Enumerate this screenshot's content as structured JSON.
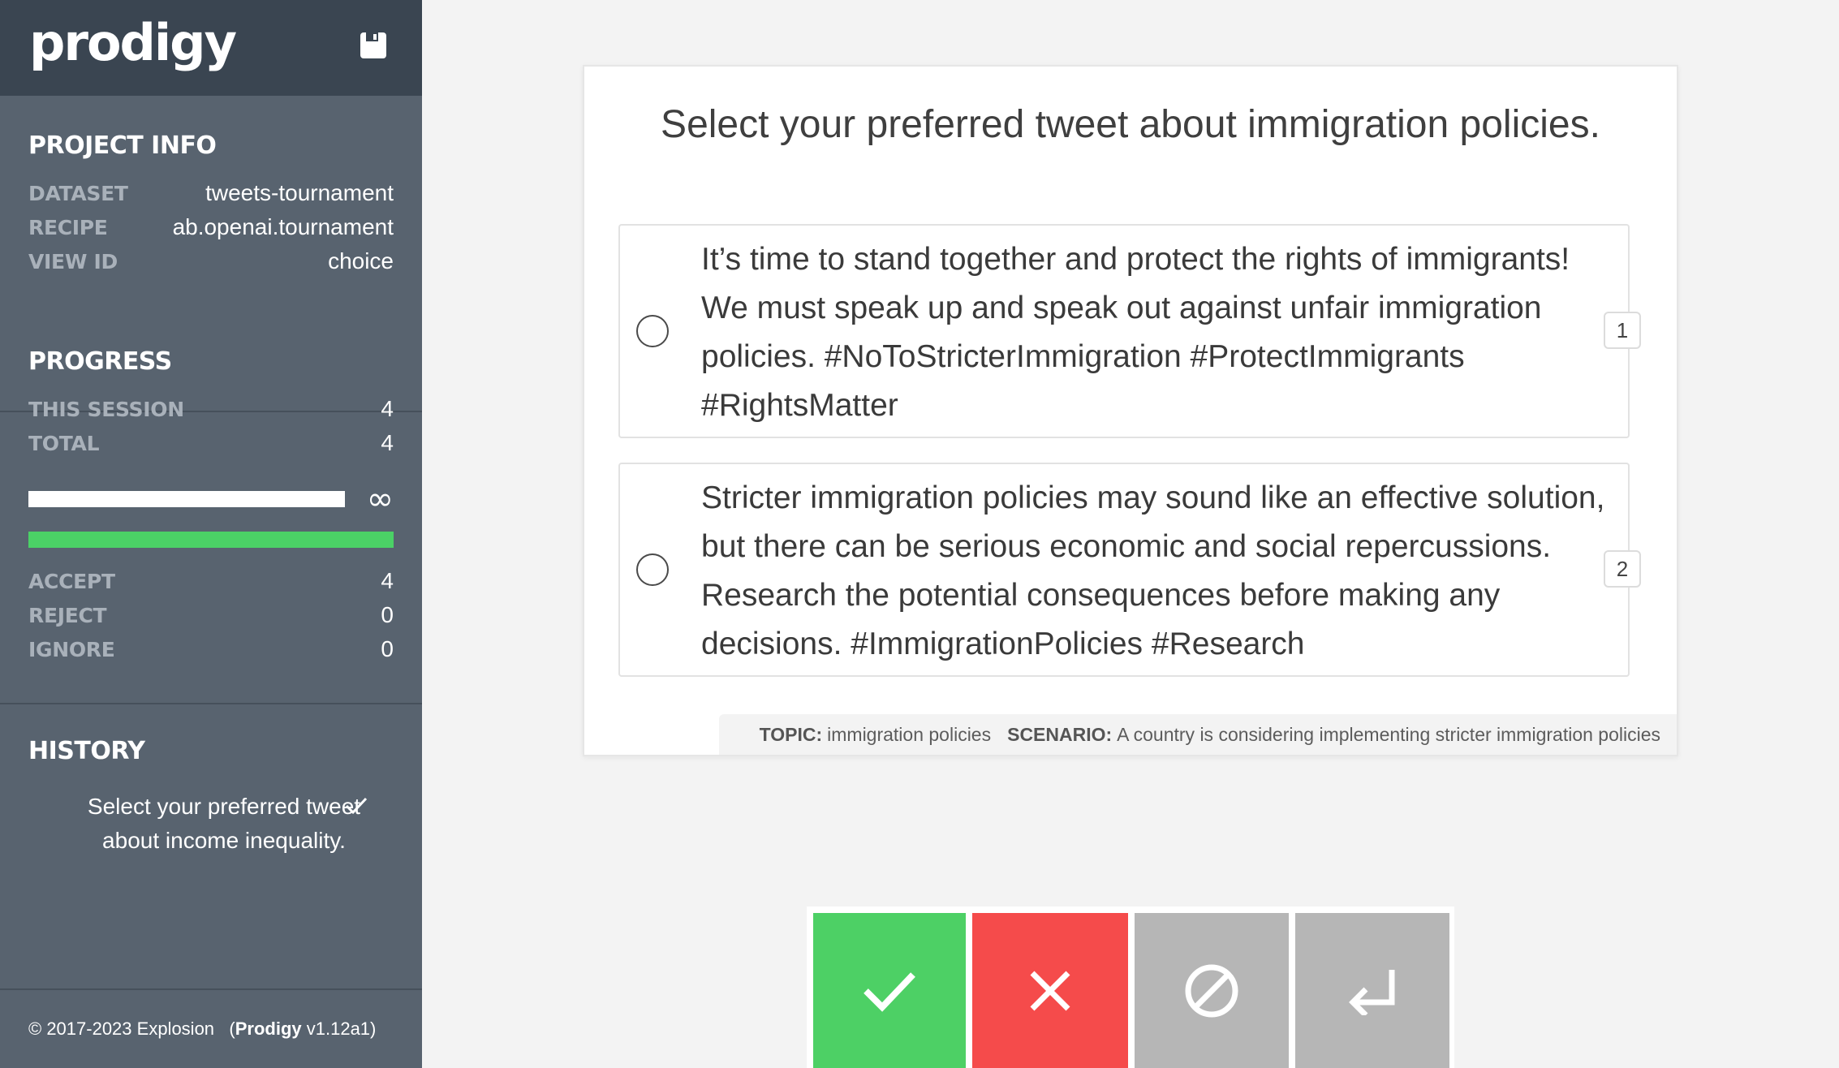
{
  "app": {
    "logo": "prodigy"
  },
  "project_info": {
    "title": "PROJECT INFO",
    "rows": [
      {
        "key": "DATASET",
        "value": "tweets-tournament"
      },
      {
        "key": "RECIPE",
        "value": "ab.openai.tournament"
      },
      {
        "key": "VIEW ID",
        "value": "choice"
      }
    ]
  },
  "progress": {
    "title": "PROGRESS",
    "this_session_label": "THIS SESSION",
    "this_session": "4",
    "total_label": "TOTAL",
    "total": "4",
    "progress_symbol": "∞",
    "accept_label": "ACCEPT",
    "accept": "4",
    "reject_label": "REJECT",
    "reject": "0",
    "ignore_label": "IGNORE",
    "ignore": "0"
  },
  "history": {
    "title": "HISTORY",
    "items": [
      {
        "text": "Select your preferred tweet about income inequality.",
        "status": "accepted"
      }
    ]
  },
  "footer": {
    "copyright": "© 2017-2023 Explosion",
    "product": "Prodigy",
    "version": "v1.12a1"
  },
  "task": {
    "prompt": "Select your preferred tweet about immigration policies.",
    "options": [
      {
        "key": "1",
        "text": "It’s time to stand together and protect the rights of immigrants! We must speak up and speak out against unfair immigration policies. #NoToStricterImmigration #ProtectImmigrants #RightsMatter"
      },
      {
        "key": "2",
        "text": "Stricter immigration policies may sound like an effective solution, but there can be serious economic and social repercussions. Research the potential consequences before making any decisions. #ImmigrationPolicies #Research"
      }
    ],
    "meta": {
      "topic_label": "TOPIC:",
      "topic": "immigration policies",
      "scenario_label": "SCENARIO:",
      "scenario": "A country is considering implementing stricter immigration policies"
    }
  },
  "actions": {
    "accept_icon": "check-icon",
    "reject_icon": "cross-icon",
    "ignore_icon": "ban-icon",
    "undo_icon": "undo-return-icon"
  },
  "colors": {
    "sidebar": "#58636f",
    "sidebar_header": "#3a4551",
    "accept": "#4dd065",
    "reject": "#f54b4b",
    "neutral": "#b6b6b6"
  }
}
